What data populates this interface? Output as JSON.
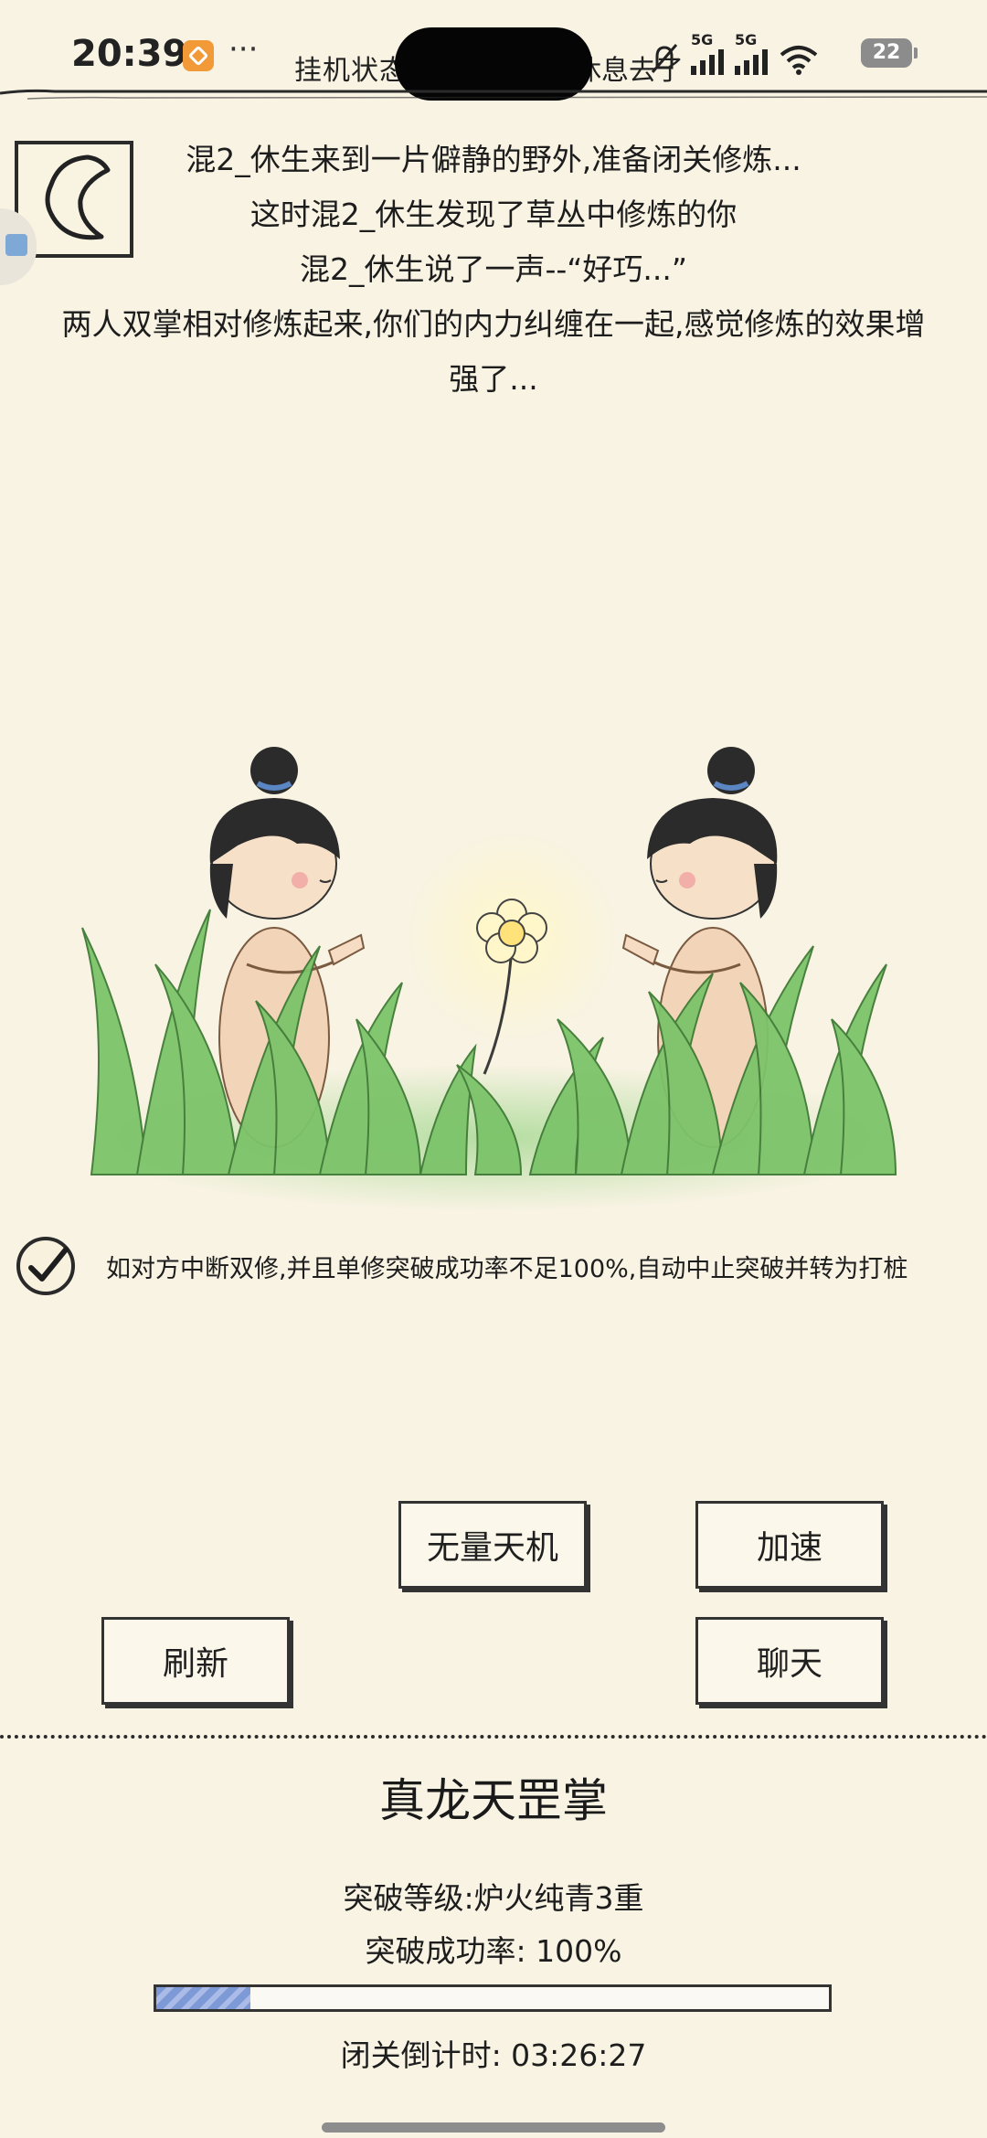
{
  "status_bar": {
    "time": "20:39",
    "more": "···",
    "net1": "5G",
    "net2": "5G",
    "battery": "22"
  },
  "header": {
    "title_left": "挂机状态",
    "title_right": "休息去了"
  },
  "story": {
    "lines": [
      "混2_休生来到一片僻静的野外,准备闭关修炼...",
      "这时混2_休生发现了草丛中修炼的你",
      "混2_休生说了一声--“好巧...”",
      "两人双掌相对修炼起来,你们的内力纠缠在一起,感觉修炼的效果增",
      "强了..."
    ]
  },
  "auto_option": {
    "checked": true,
    "label": "如对方中断双修,并且单修突破成功率不足100%,自动中止突破并转为打桩"
  },
  "buttons": {
    "wuliang": "无量天机",
    "speedup": "加速",
    "refresh": "刷新",
    "chat": "聊天"
  },
  "skill": {
    "name": "真龙天罡掌",
    "level_text": "突破等级:炉火纯青3重",
    "rate_text": "突破成功率: 100%",
    "progress": 0.14,
    "countdown_text": "闭关倒计时: 03:26:27"
  },
  "colors": {
    "background": "#f8f3e3",
    "progress_fill": "#7e9ad6",
    "grass": "#7cc46a",
    "hair": "#2b2b2b"
  }
}
